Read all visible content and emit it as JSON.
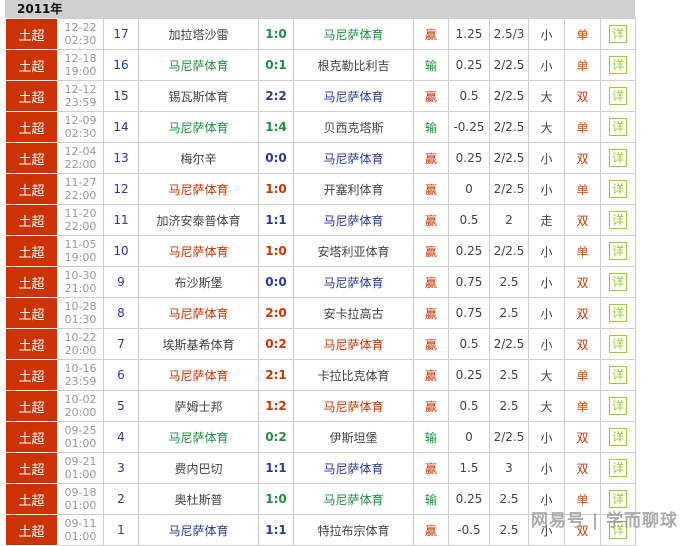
{
  "year": "2011年",
  "colors": {
    "win": "#cc3300",
    "draw": "#2a3a9a",
    "loss": "#1f8f3f",
    "league_bg": "#cc3300"
  },
  "detail_label": "详",
  "watermark": "网易号 | 学而聊球",
  "rows": [
    {
      "league": "土超",
      "date": "12-22",
      "time": "02:30",
      "round": "17",
      "home": "加拉塔沙雷",
      "score": "1:0",
      "away": "马尼萨体育",
      "res": "loss",
      "manisa": "away",
      "hc": "赢",
      "line": "1.25",
      "ou": "2.5/3",
      "bs": "小",
      "oe": "单"
    },
    {
      "league": "土超",
      "date": "12-18",
      "time": "19:00",
      "round": "16",
      "home": "马尼萨体育",
      "score": "0:1",
      "away": "根克勒比利吉",
      "res": "loss",
      "manisa": "home",
      "hc": "输",
      "line": "0.25",
      "ou": "2/2.5",
      "bs": "小",
      "oe": "单"
    },
    {
      "league": "土超",
      "date": "12-12",
      "time": "23:59",
      "round": "15",
      "home": "锡瓦斯体育",
      "score": "2:2",
      "away": "马尼萨体育",
      "res": "draw",
      "manisa": "away",
      "hc": "赢",
      "line": "0.5",
      "ou": "2/2.5",
      "bs": "大",
      "oe": "双"
    },
    {
      "league": "土超",
      "date": "12-09",
      "time": "02:30",
      "round": "14",
      "home": "马尼萨体育",
      "score": "1:4",
      "away": "贝西克塔斯",
      "res": "loss",
      "manisa": "home",
      "hc": "输",
      "line": "-0.25",
      "ou": "2/2.5",
      "bs": "大",
      "oe": "单"
    },
    {
      "league": "土超",
      "date": "12-04",
      "time": "22:00",
      "round": "13",
      "home": "梅尔辛",
      "score": "0:0",
      "away": "马尼萨体育",
      "res": "draw",
      "manisa": "away",
      "hc": "赢",
      "line": "0.25",
      "ou": "2/2.5",
      "bs": "小",
      "oe": "双"
    },
    {
      "league": "土超",
      "date": "11-27",
      "time": "22:00",
      "round": "12",
      "home": "马尼萨体育",
      "score": "1:0",
      "away": "开塞利体育",
      "res": "win",
      "manisa": "home",
      "hc": "赢",
      "line": "0",
      "ou": "2/2.5",
      "bs": "小",
      "oe": "单"
    },
    {
      "league": "土超",
      "date": "11-20",
      "time": "22:00",
      "round": "11",
      "home": "加济安泰普体育",
      "score": "1:1",
      "away": "马尼萨体育",
      "res": "draw",
      "manisa": "away",
      "hc": "赢",
      "line": "0.5",
      "ou": "2",
      "bs": "走",
      "oe": "双"
    },
    {
      "league": "土超",
      "date": "11-05",
      "time": "19:00",
      "round": "10",
      "home": "马尼萨体育",
      "score": "1:0",
      "away": "安塔利亚体育",
      "res": "win",
      "manisa": "home",
      "hc": "赢",
      "line": "0.25",
      "ou": "2/2.5",
      "bs": "小",
      "oe": "单"
    },
    {
      "league": "土超",
      "date": "10-30",
      "time": "21:00",
      "round": "9",
      "home": "布沙斯堡",
      "score": "0:0",
      "away": "马尼萨体育",
      "res": "draw",
      "manisa": "away",
      "hc": "赢",
      "line": "0.75",
      "ou": "2.5",
      "bs": "小",
      "oe": "双"
    },
    {
      "league": "土超",
      "date": "10-28",
      "time": "01:30",
      "round": "8",
      "home": "马尼萨体育",
      "score": "2:0",
      "away": "安卡拉高古",
      "res": "win",
      "manisa": "home",
      "hc": "赢",
      "line": "0.75",
      "ou": "2.5",
      "bs": "小",
      "oe": "双"
    },
    {
      "league": "土超",
      "date": "10-22",
      "time": "20:00",
      "round": "7",
      "home": "埃斯基希体育",
      "score": "0:2",
      "away": "马尼萨体育",
      "res": "win",
      "manisa": "away",
      "hc": "赢",
      "line": "0.5",
      "ou": "2/2.5",
      "bs": "小",
      "oe": "双"
    },
    {
      "league": "土超",
      "date": "10-16",
      "time": "23:59",
      "round": "6",
      "home": "马尼萨体育",
      "score": "2:1",
      "away": "卡拉比克体育",
      "res": "win",
      "manisa": "home",
      "hc": "赢",
      "line": "0.25",
      "ou": "2.5",
      "bs": "大",
      "oe": "单"
    },
    {
      "league": "土超",
      "date": "10-02",
      "time": "20:00",
      "round": "5",
      "home": "萨姆士邦",
      "score": "1:2",
      "away": "马尼萨体育",
      "res": "win",
      "manisa": "away",
      "hc": "赢",
      "line": "0.5",
      "ou": "2.5",
      "bs": "大",
      "oe": "单"
    },
    {
      "league": "土超",
      "date": "09-25",
      "time": "01:00",
      "round": "4",
      "home": "马尼萨体育",
      "score": "0:2",
      "away": "伊斯坦堡",
      "res": "loss",
      "manisa": "home",
      "hc": "输",
      "line": "0",
      "ou": "2/2.5",
      "bs": "小",
      "oe": "双"
    },
    {
      "league": "土超",
      "date": "09-21",
      "time": "01:00",
      "round": "3",
      "home": "费内巴切",
      "score": "1:1",
      "away": "马尼萨体育",
      "res": "draw",
      "manisa": "away",
      "hc": "赢",
      "line": "1.5",
      "ou": "3",
      "bs": "小",
      "oe": "双"
    },
    {
      "league": "土超",
      "date": "09-18",
      "time": "01:00",
      "round": "2",
      "home": "奥杜斯普",
      "score": "1:0",
      "away": "马尼萨体育",
      "res": "loss",
      "manisa": "away",
      "hc": "输",
      "line": "0.25",
      "ou": "2.5",
      "bs": "小",
      "oe": "单"
    },
    {
      "league": "土超",
      "date": "09-11",
      "time": "01:00",
      "round": "1",
      "home": "马尼萨体育",
      "score": "1:1",
      "away": "特拉布宗体育",
      "res": "draw",
      "manisa": "home",
      "hc": "赢",
      "line": "-0.5",
      "ou": "2.5",
      "bs": "小",
      "oe": "双"
    }
  ]
}
